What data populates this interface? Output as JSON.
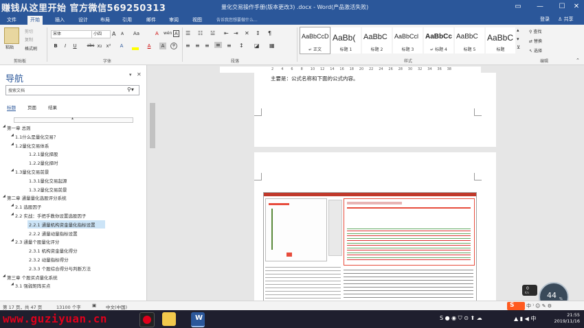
{
  "watermark": "赚钱从这里开始 官方微信569250313",
  "window": {
    "doc_title": "量化交易操作手册(版本更改3) .docx - Word(产品激活失败)",
    "controls": [
      "▭",
      "—",
      "☐",
      "✕"
    ]
  },
  "tabs": [
    "文件",
    "开始",
    "插入",
    "设计",
    "布局",
    "引用",
    "邮件",
    "审阅",
    "视图"
  ],
  "active_tab_index": 1,
  "tell_me": "告诉我您想要做什么...",
  "account": {
    "login": "登录",
    "share": "共享"
  },
  "ribbon": {
    "clipboard": {
      "paste": "粘贴",
      "cut": "剪切",
      "copy": "复制",
      "format_painter": "格式刷",
      "label": "剪贴板"
    },
    "font": {
      "name": "宋体",
      "size": "小四",
      "label": "字体",
      "bold": "B",
      "italic": "I",
      "underline": "U",
      "strike": "abc",
      "sub": "x₂",
      "sup": "x²",
      "grow": "A",
      "shrink": "A",
      "case": "Aa",
      "clear": "A",
      "phonetic": "wén",
      "border_char": "A"
    },
    "paragraph": {
      "label": "段落"
    },
    "styles": {
      "label": "样式",
      "items": [
        {
          "preview": "AaBbCcD",
          "name": "↵ 正文"
        },
        {
          "preview": "AaBb(",
          "name": "标题 1"
        },
        {
          "preview": "AaBbC",
          "name": "标题 2"
        },
        {
          "preview": "AaBbCcl",
          "name": "标题 3"
        },
        {
          "preview": "AaBbCc",
          "name": "↵ 标题 4"
        },
        {
          "preview": "AaBbC",
          "name": "标题 5"
        },
        {
          "preview": "AaBbC",
          "name": "标题"
        }
      ]
    },
    "editing": {
      "find": "查找",
      "replace": "替换",
      "select": "选择",
      "label": "编辑"
    }
  },
  "nav": {
    "title": "导航",
    "search_placeholder": "搜索文档",
    "tabs": [
      "标题",
      "页面",
      "结果"
    ],
    "items": [
      {
        "text": "第一章 总则",
        "level": 0
      },
      {
        "text": "1.1什么是量化交易？",
        "level": 1
      },
      {
        "text": "1.2量化交易体系",
        "level": 1
      },
      {
        "text": "1.2.1量化择股",
        "level": 2
      },
      {
        "text": "1.2.2量化择时",
        "level": 2
      },
      {
        "text": "1.3量化交易前景",
        "level": 1
      },
      {
        "text": "1.3.1量化交易起源",
        "level": 2
      },
      {
        "text": "1.3.2量化交易前景",
        "level": 2
      },
      {
        "text": "第二章 通量量化选股评分系统",
        "level": 0
      },
      {
        "text": "2.1 选股因子",
        "level": 1
      },
      {
        "text": "2.2 实战：手把手教你设置选股因子",
        "level": 1
      },
      {
        "text": "2.2.1 通量机构资金量化指标设置",
        "level": 2,
        "selected": true
      },
      {
        "text": "2.2.2 通量动量指标设置",
        "level": 2
      },
      {
        "text": "2.3 通量个股量化评分",
        "level": 1
      },
      {
        "text": "2.3.1 机构资金量化得分",
        "level": 2
      },
      {
        "text": "2.3.2 动量指标得分",
        "level": 2
      },
      {
        "text": "2.3.3 个股综合得分与判断方法",
        "level": 2
      },
      {
        "text": "第三章 个股买点量化系统",
        "level": 0
      },
      {
        "text": "3.1 强弱矩阵买点",
        "level": 1
      }
    ]
  },
  "ruler_ticks": [
    "2",
    "4",
    "6",
    "8",
    "10",
    "12",
    "14",
    "16",
    "18",
    "20",
    "22",
    "24",
    "26",
    "28",
    "30",
    "32",
    "34",
    "36",
    "38"
  ],
  "document": {
    "top_line": "主要是：公式名称和下面的公式内容。"
  },
  "status": {
    "page": "第 17 页，共 47 页",
    "words": "13100 个字",
    "lang": "中文(中国)"
  },
  "overlay": {
    "percent": "44",
    "speed": "0",
    "unit": "K/s"
  },
  "taskbar": {
    "site": "www.guziyuan.cn",
    "time": "21:55",
    "date": "2019/11/16"
  }
}
